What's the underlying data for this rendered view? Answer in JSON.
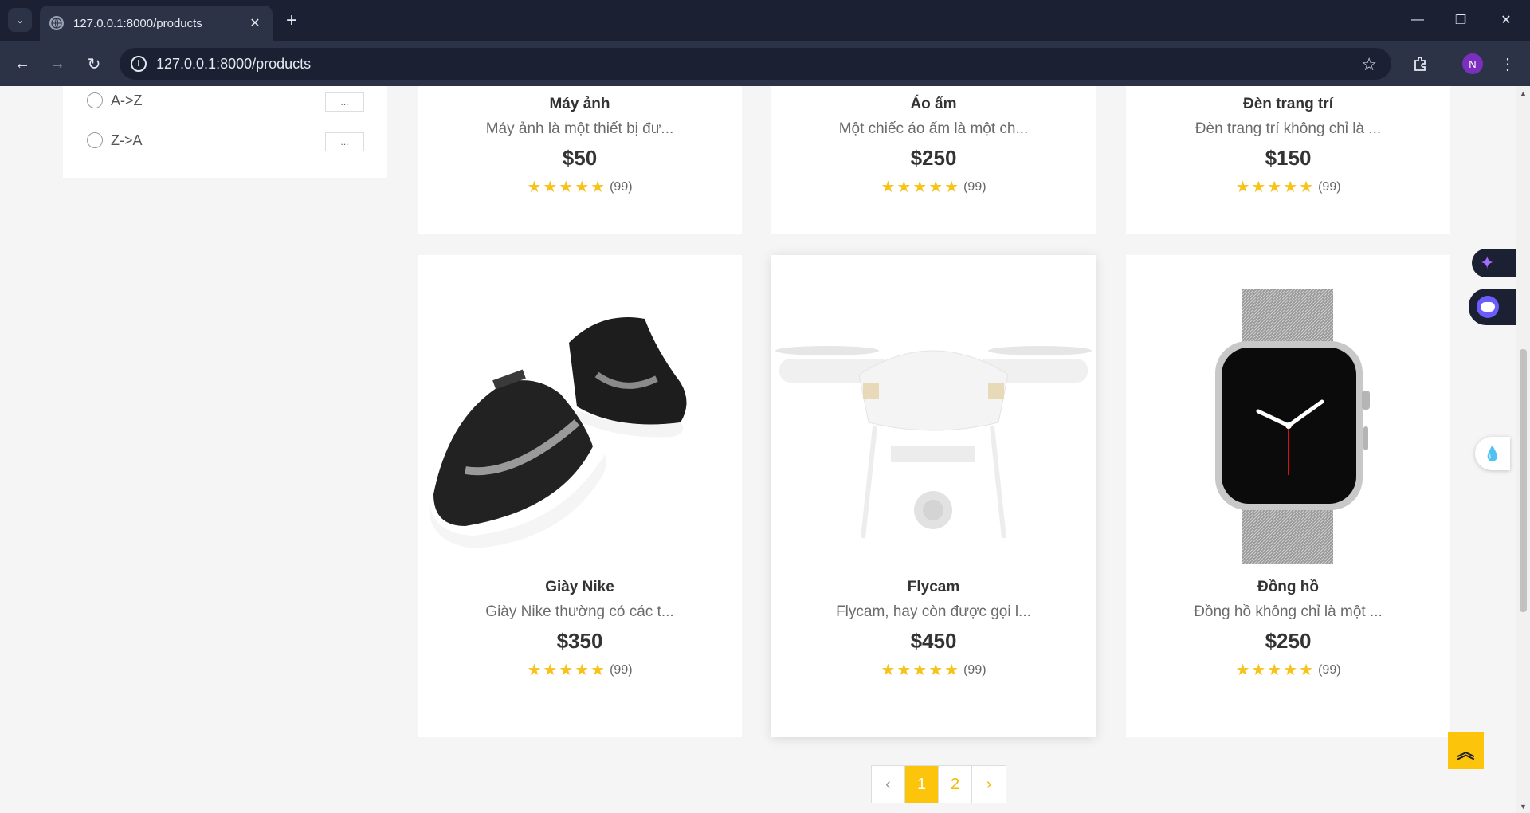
{
  "browser": {
    "tab_title": "127.0.0.1:8000/products",
    "url": "127.0.0.1:8000/products",
    "profile_initial": "N"
  },
  "sort": {
    "options": [
      {
        "label": "A->Z",
        "button": "..."
      },
      {
        "label": "Z->A",
        "button": "..."
      }
    ]
  },
  "products_top": [
    {
      "name": "Máy ảnh",
      "desc": "Máy ảnh là một thiết bị đư...",
      "price": "$50",
      "stars": "★★★★★",
      "count": "(99)"
    },
    {
      "name": "Áo ấm",
      "desc": "Một chiếc áo ấm là một ch...",
      "price": "$250",
      "stars": "★★★★★",
      "count": "(99)"
    },
    {
      "name": "Đèn trang trí",
      "desc": "Đèn trang trí không chỉ là ...",
      "price": "$150",
      "stars": "★★★★★",
      "count": "(99)"
    }
  ],
  "products": [
    {
      "name": "Giày Nike",
      "desc": "Giày Nike thường có các t...",
      "price": "$350",
      "stars": "★★★★★",
      "count": "(99)"
    },
    {
      "name": "Flycam",
      "desc": "Flycam, hay còn được gọi l...",
      "price": "$450",
      "stars": "★★★★★",
      "count": "(99)"
    },
    {
      "name": "Đồng hồ",
      "desc": "Đồng hồ không chỉ là một ...",
      "price": "$250",
      "stars": "★★★★★",
      "count": "(99)"
    }
  ],
  "pagination": {
    "prev": "‹",
    "pages": [
      "1",
      "2"
    ],
    "next": "›",
    "active": "1"
  },
  "colors": {
    "accent": "#fcc50c",
    "star": "#f7c21a",
    "chrome": "#1b2133"
  }
}
